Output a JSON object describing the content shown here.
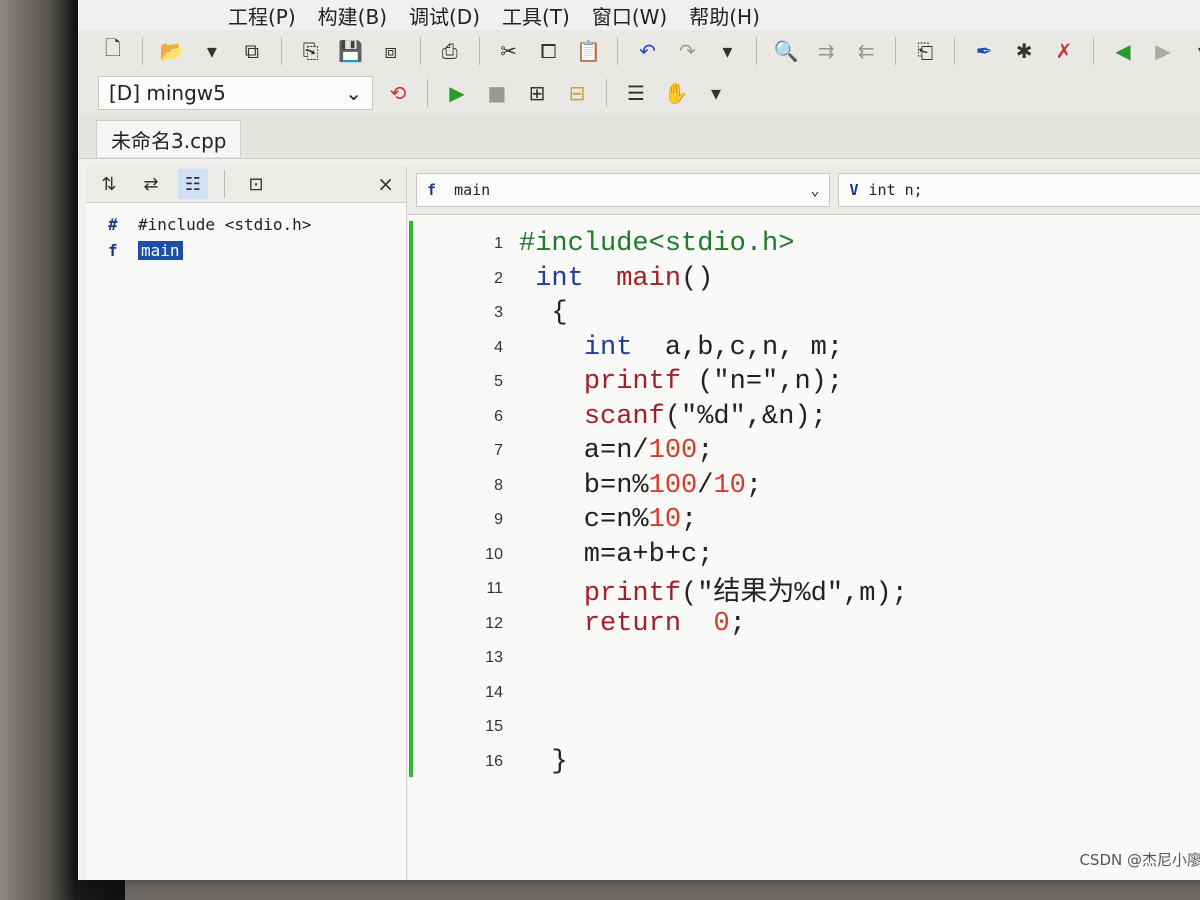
{
  "menu": [
    "工程(P)",
    "构建(B)",
    "调试(D)",
    "工具(T)",
    "窗口(W)",
    "帮助(H)"
  ],
  "toolbar": {
    "compiler": "[D] mingw5"
  },
  "tabs": [
    {
      "label": "未命名3.cpp"
    }
  ],
  "class_browser": {
    "items": [
      {
        "icon": "#",
        "label": "#include <stdio.h>"
      },
      {
        "icon": "f",
        "label": "main"
      }
    ],
    "close": "×"
  },
  "scope_bar": {
    "function": "main",
    "variable": "int n;"
  },
  "editor": {
    "lines": [
      {
        "n": "1",
        "text": "#include<stdio.h>"
      },
      {
        "n": "2",
        "text": " int  main()"
      },
      {
        "n": "3",
        "text": "  {"
      },
      {
        "n": "4",
        "text": "    int  a,b,c,n, m;"
      },
      {
        "n": "5",
        "text": "    printf (\"n=\",n);"
      },
      {
        "n": "6",
        "text": "    scanf(\"%d\",&n);"
      },
      {
        "n": "7",
        "text": "    a=n/100;"
      },
      {
        "n": "8",
        "text": "    b=n%100/10;"
      },
      {
        "n": "9",
        "text": "    c=n%10;"
      },
      {
        "n": "10",
        "text": "    m=a+b+c;"
      },
      {
        "n": "11",
        "text": "    printf(\"结果为%d\",m);"
      },
      {
        "n": "12",
        "text": "    return  0;"
      },
      {
        "n": "13",
        "text": ""
      },
      {
        "n": "14",
        "text": ""
      },
      {
        "n": "15",
        "text": ""
      },
      {
        "n": "16",
        "text": "  }"
      }
    ]
  },
  "watermark": "CSDN @杰尼小廖"
}
